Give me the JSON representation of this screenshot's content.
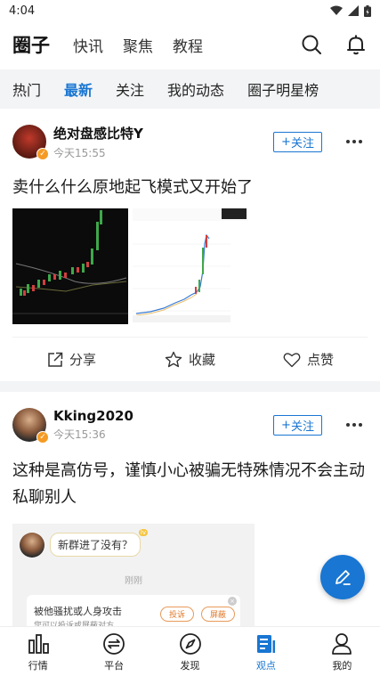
{
  "status_bar": {
    "time": "4:04"
  },
  "top_nav": {
    "tabs": [
      {
        "label": "圈子",
        "active": true
      },
      {
        "label": "快讯"
      },
      {
        "label": "聚焦"
      },
      {
        "label": "教程"
      }
    ],
    "icons": [
      "search-icon",
      "bell-icon"
    ]
  },
  "sub_tabs": [
    {
      "label": "热门"
    },
    {
      "label": "最新",
      "active": true
    },
    {
      "label": "关注"
    },
    {
      "label": "我的动态"
    },
    {
      "label": "圈子明星榜"
    }
  ],
  "posts": [
    {
      "author": "绝对盘感比特Y",
      "time": "今天15:55",
      "follow_label": "关注",
      "text": "卖什么什么原地起飞模式又开始了",
      "actions": {
        "share": "分享",
        "collect": "收藏",
        "like": "点赞"
      }
    },
    {
      "author": "Kking2020",
      "time": "今天15:36",
      "follow_label": "关注",
      "text": "这种是高仿号，谨慎小心被骗无特殊情况不会主动私聊别人",
      "image": {
        "chat_text": "新群进了没有？",
        "level_badge": "lv",
        "time_label": "刚刚",
        "report_title": "被他骚扰或人身攻击",
        "report_sub": "您可以投诉或屏蔽对方",
        "complain": "投诉",
        "block": "屏蔽"
      }
    }
  ],
  "bottom_nav": [
    {
      "label": "行情",
      "icon": "bar-chart-icon"
    },
    {
      "label": "平台",
      "icon": "exchange-icon"
    },
    {
      "label": "发现",
      "icon": "compass-icon"
    },
    {
      "label": "观点",
      "icon": "article-icon",
      "active": true
    },
    {
      "label": "我的",
      "icon": "user-icon"
    }
  ],
  "colors": {
    "accent": "#1976d2",
    "badge": "#f59b23",
    "bg_gray": "#f3f4f6"
  }
}
